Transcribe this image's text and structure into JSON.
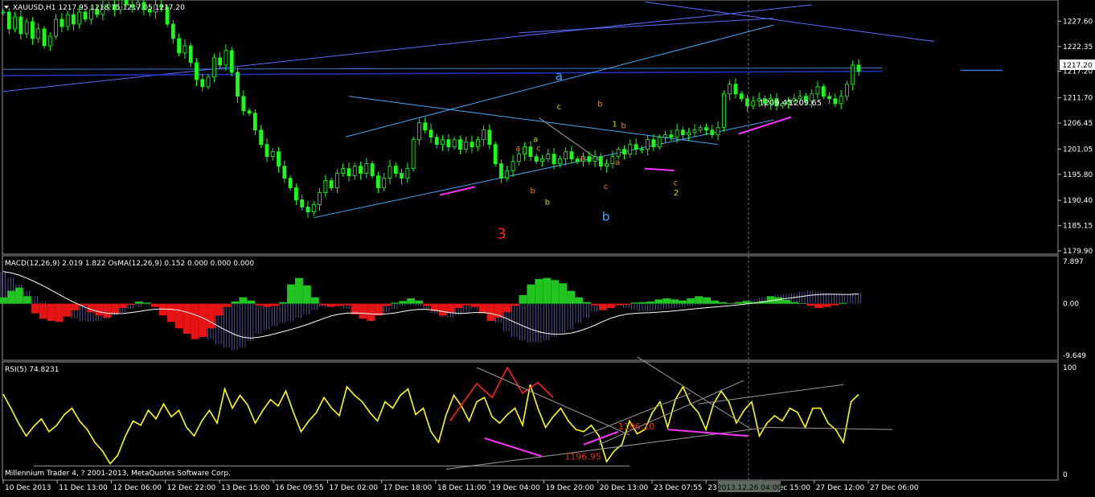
{
  "terminal": {
    "footer_credit": "Millennium Trader 4, ? 2001-2013, MetaQuotes Software Corp.",
    "crosshair_time_label": "2013.12.26 04:00"
  },
  "chart_data": [
    {
      "type": "candlestick",
      "header": "XAUUSD,H1  1217.95 1218.75 1217.05 1217.20",
      "symbol": "XAUUSD",
      "timeframe": "H1",
      "ohlc_last": {
        "open": 1217.95,
        "high": 1218.75,
        "low": 1217.05,
        "close": 1217.2
      },
      "current_price_label": "1217.20",
      "y_ticks": [
        "1227.60",
        "1222.35",
        "1217.20",
        "1211.70",
        "1206.45",
        "1201.05",
        "1195.80",
        "1190.40",
        "1185.15",
        "1179.90"
      ],
      "ylim": [
        1179.9,
        1229.5
      ],
      "x_tick_labels": [
        "10 Dec 2013",
        "11 Dec 13:00",
        "12 Dec 06:00",
        "12 Dec 22:00",
        "13 Dec 15:00",
        "16 Dec 09:55",
        "17 Dec 02:00",
        "17 Dec 18:00",
        "18 Dec 11:00",
        "19 Dec 04:00",
        "19 Dec 20:00",
        "20 Dec 13:00",
        "23 Dec 07:55",
        "23 Dec 23:55",
        "24 Dec 15:00",
        "27 Dec 12:00",
        "27 Dec 06:00"
      ],
      "series": [
        {
          "values": [
            1229.5,
            1226,
            1228.5,
            1225,
            1227.5,
            1224,
            1226,
            1222.5,
            1224.5,
            1228,
            1226.5,
            1229,
            1227,
            1229.5,
            1228,
            1230,
            1229,
            1230.5,
            1231,
            1230,
            1232,
            1231,
            1230.5,
            1231.5,
            1230,
            1229.5,
            1231,
            1230.5,
            1227,
            1224,
            1221,
            1222.5,
            1219,
            1215.5,
            1214,
            1216,
            1220,
            1218.5,
            1221.5,
            1217,
            1212,
            1209,
            1208.5,
            1205,
            1202,
            1199.5,
            1200.5,
            1197.5,
            1195,
            1193,
            1190.5,
            1189,
            1188,
            1189.5,
            1192,
            1194.5,
            1193,
            1196,
            1197,
            1195.5,
            1197.5,
            1196,
            1198,
            1195.5,
            1193,
            1195,
            1197.5,
            1196,
            1195,
            1197,
            1203,
            1206.5,
            1205,
            1203.5,
            1202,
            1203,
            1201.5,
            1203,
            1201,
            1202.5,
            1201.5,
            1203,
            1205,
            1202,
            1198,
            1195,
            1196.5,
            1198.5,
            1200,
            1201.5,
            1199.5,
            1198.5,
            1199,
            1200,
            1198,
            1199,
            1200.5,
            1199,
            1198.5,
            1199.5,
            1198.5,
            1199.5,
            1197.5,
            1198,
            1199.5,
            1201,
            1200,
            1202,
            1201,
            1201,
            1203,
            1201.5,
            1203.5,
            1204,
            1203.5,
            1205,
            1204,
            1204.5,
            1205,
            1205.5,
            1205,
            1204,
            1205.5,
            1212.5,
            1214.5,
            1212.5,
            1211.5,
            1210,
            1211,
            1211.5,
            1210.5,
            1211.5,
            1210,
            1210.5,
            1211,
            1211.5,
            1212,
            1211,
            1212.5,
            1214,
            1212,
            1211.5,
            1210.5,
            1212,
            1214.5,
            1218.5,
            1217.2
          ]
        },
        {
          "name": "MACD(12,26,9) 2.019 1.822  OsMA(12,26,9) 0.152 0.000 0.000 0.000",
          "y_ticks": [
            "7.897",
            "0.00",
            "-9.649"
          ],
          "ylim": [
            -9.649,
            7.897
          ],
          "macd": [
            6,
            4.8,
            3.6,
            2.4,
            1.4,
            0.4,
            -0.6,
            -1.6,
            -2.4,
            -2.8,
            -3.2,
            -3.4,
            -3.2,
            -2.8,
            -2.2,
            -1.6,
            -1,
            -0.6,
            -0.2,
            -0.4,
            -0.8,
            -1.2,
            -2,
            -3,
            -4,
            -5,
            -6.6,
            -7.6,
            -8.2,
            -8.6,
            -8.2,
            -7,
            -5.6,
            -4.8,
            -4.2,
            -3.6,
            -3.2,
            -2.6,
            -2,
            -1.2,
            -0.6,
            -0.2,
            -0.6,
            -1,
            -1.6,
            -2,
            -2.4,
            -2.2,
            -1.6,
            -1,
            -0.4,
            -0.2,
            -0.4,
            -1.2,
            -1.8,
            -2.4,
            -2.6,
            -2.2,
            -1.6,
            -1.2,
            -1.6,
            -2.6,
            -3.6,
            -5.2,
            -6.2,
            -6.8,
            -7.2,
            -7.2,
            -6.8,
            -6.2,
            -5.6,
            -4.8,
            -3.6,
            -2.6,
            -1.6,
            -0.6,
            -0.2,
            -0.4,
            -0.8,
            -1.2,
            -1.4,
            -1.4,
            -1.2,
            -1,
            -0.8,
            -0.6,
            -0.4,
            -0.3,
            -0.2,
            -0.1,
            0,
            0.2,
            0.4,
            0.6,
            0.8,
            1.2,
            1.4,
            1.6,
            1.8,
            2,
            2.2,
            2.4,
            2.2,
            2,
            1.8,
            1.6,
            1.8,
            2.019
          ],
          "osma": [
            1.2,
            2.4,
            3,
            1.4,
            -1.8,
            -2.8,
            -3.2,
            -3.4,
            -2.4,
            -1.2,
            -0.4,
            -1.6,
            -2.2,
            -2.6,
            -1.8,
            -0.8,
            -0.2,
            0.4,
            0.2,
            -0.6,
            -2.2,
            -3.4,
            -4.6,
            -5.6,
            -6.6,
            -6.2,
            -4.6,
            -2.2,
            -0.6,
            0.4,
            1.2,
            0.6,
            -0.3,
            -0.6,
            -0.4,
            0.3,
            3.6,
            4.8,
            3.4,
            1.2,
            -0.3,
            -0.6,
            -0.4,
            -0.3,
            -2,
            -2.8,
            -3.2,
            -2.2,
            -0.4,
            0.2,
            0.5,
            1,
            0.6,
            -0.4,
            -1.4,
            -2.2,
            -1.6,
            -0.8,
            -0.3,
            -0.6,
            -1.8,
            -3.2,
            -2.6,
            -1.6,
            -0.4,
            1.6,
            3.6,
            4.6,
            4.8,
            4.4,
            3.8,
            2.4,
            1.2,
            0.3,
            -0.3,
            -1.2,
            -0.8,
            -0.3,
            -0.2,
            0.2,
            0.3,
            0.4,
            0.8,
            1,
            0.8,
            0.6,
            1,
            1.4,
            1.2,
            0.6,
            0.3,
            0.1,
            0.3,
            0.5,
            0.3,
            0.5,
            1.4,
            1.2,
            0.7,
            0.3,
            0.1,
            -0.4,
            -0.8,
            -0.6,
            -0.3,
            0.152
          ]
        },
        {
          "name": "RSI(5) 74.8231",
          "y_ticks": [
            "100",
            "0"
          ],
          "ylim": [
            0,
            100
          ],
          "values": [
            75,
            62,
            48,
            36,
            45,
            52,
            40,
            46,
            56,
            62,
            50,
            42,
            30,
            22,
            10,
            18,
            36,
            50,
            46,
            60,
            52,
            66,
            54,
            60,
            44,
            36,
            50,
            60,
            48,
            80,
            62,
            74,
            65,
            48,
            60,
            70,
            64,
            78,
            58,
            40,
            50,
            58,
            72,
            62,
            55,
            82,
            74,
            68,
            58,
            50,
            68,
            62,
            74,
            80,
            56,
            62,
            40,
            30,
            56,
            74,
            64,
            50,
            68,
            72,
            54,
            48,
            56,
            62,
            46,
            84,
            62,
            44,
            54,
            62,
            50,
            42,
            40,
            46,
            36,
            12,
            22,
            28,
            50,
            38,
            42,
            58,
            68,
            44,
            70,
            82,
            66,
            58,
            42,
            66,
            78,
            68,
            48,
            60,
            68,
            36,
            48,
            55,
            50,
            62,
            58,
            44,
            62,
            62,
            48,
            42,
            30,
            68,
            74.8
          ]
        }
      ],
      "annotations": [
        {
          "text": "a"
        },
        {
          "text": "c"
        },
        {
          "text": "b"
        },
        {
          "text": "1"
        },
        {
          "text": "b"
        },
        {
          "text": "a"
        },
        {
          "text": "c"
        },
        {
          "text": "a"
        },
        {
          "text": "a"
        },
        {
          "text": "b"
        },
        {
          "text": "b"
        },
        {
          "text": "a"
        },
        {
          "text": "c"
        },
        {
          "text": "2"
        },
        {
          "text": "c"
        },
        {
          "text": "b"
        },
        {
          "text": "3"
        },
        {
          "text": "1209.45"
        },
        {
          "text": "1209.65"
        },
        {
          "text": "1196.10"
        },
        {
          "text": "1196.95"
        }
      ]
    }
  ]
}
